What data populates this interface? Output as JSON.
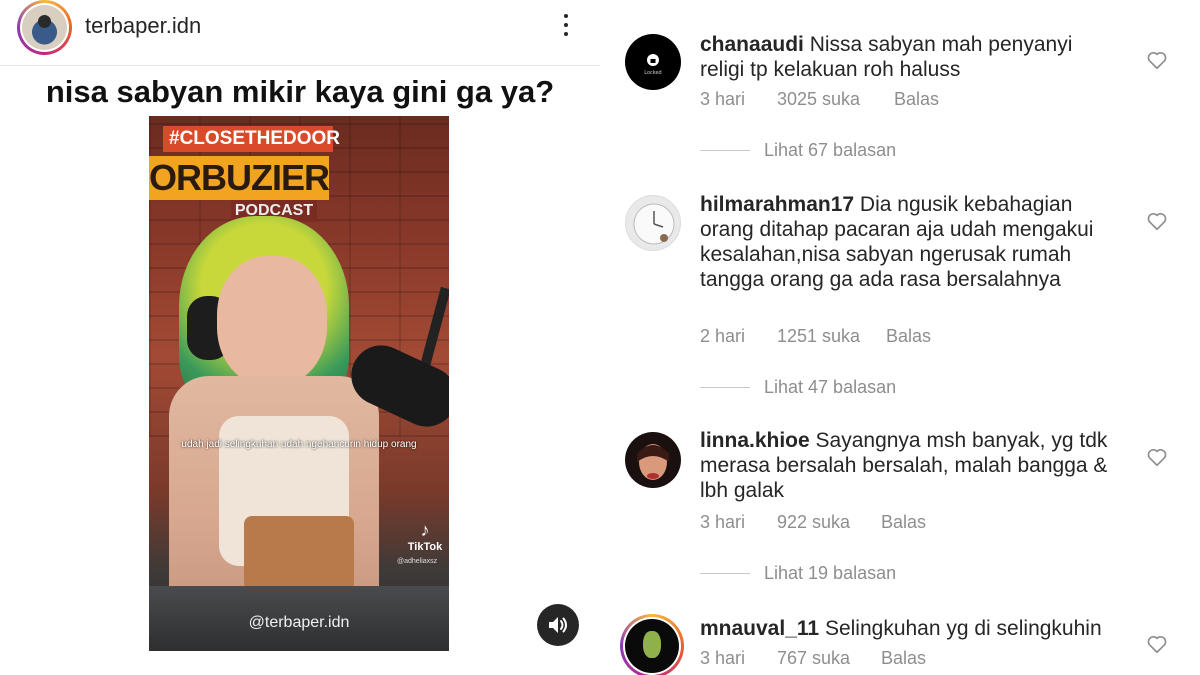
{
  "post": {
    "account": "terbaper.idn",
    "title": "nisa sabyan mikir kaya gini ga ya?",
    "video": {
      "sign_top": "#CLOSETHEDOOR",
      "sign_main": "ORBUZIER",
      "sign_sub": "PODCAST",
      "caption": "udah jadi selingkuhan udah ngehancurin hidup orang",
      "tiktok_label": "TikTok",
      "tiktok_handle": "@adheliaxsz",
      "watermark": "@terbaper.idn"
    }
  },
  "comments": [
    {
      "username": "chanaaudi",
      "text": "Nissa sabyan mah penyanyi religi tp kelakuan roh haluss",
      "time": "3 hari",
      "likes": "3025 suka",
      "reply": "Balas",
      "view_replies": "Lihat 67 balasan",
      "avatar_label": "Locked"
    },
    {
      "username": "hilmarahman17",
      "text": "Dia ngusik kebahagian orang ditahap pacaran aja udah mengakui kesalahan,nisa sabyan ngerusak rumah tangga orang ga ada rasa bersalahnya",
      "time": "2 hari",
      "likes": "1251 suka",
      "reply": "Balas",
      "view_replies": "Lihat 47 balasan"
    },
    {
      "username": "linna.khioe",
      "text": "Sayangnya msh banyak, yg tdk merasa bersalah  bersalah, malah bangga & lbh galak",
      "time": "3 hari",
      "likes": "922 suka",
      "reply": "Balas",
      "view_replies": "Lihat 19 balasan"
    },
    {
      "username": "mnauval_11",
      "text": "Selingkuhan yg di selingkuhin",
      "time": "3 hari",
      "likes": "767 suka",
      "reply": "Balas"
    }
  ],
  "icons": {
    "more": "more-vertical-icon",
    "sound": "speaker-icon",
    "like": "heart-outline-icon"
  },
  "colors": {
    "text": "#262626",
    "meta": "#8e8e8e",
    "story_ring": "#c0287f"
  }
}
